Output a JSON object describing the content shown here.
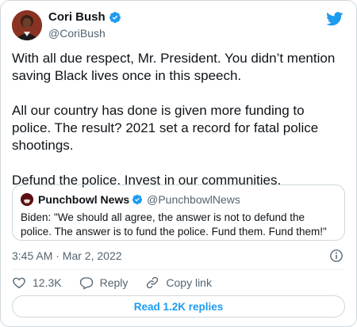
{
  "author": {
    "name": "Cori Bush",
    "handle": "@CoriBush",
    "avatar_icon": "profile-photo"
  },
  "tweet": {
    "paragraphs": [
      "With all due respect, Mr. President. You didn’t mention saving Black lives once in this speech.",
      "All our country has done is given more funding to police. The result? 2021 set a record for fatal police shootings.",
      "Defund the police. Invest in our communities."
    ],
    "timestamp": "3:45 AM · Mar 2, 2022"
  },
  "quoted": {
    "name": "Punchbowl News",
    "handle": "@PunchbowlNews",
    "text": "Biden: \"We should all agree, the answer is not to defund the police. The answer is to fund the police. Fund them. Fund them!\""
  },
  "actions": {
    "like_count": "12.3K",
    "reply_label": "Reply",
    "copy_label": "Copy link"
  },
  "replies_button": "Read 1.2K replies",
  "colors": {
    "accent": "#1d9bf0",
    "text": "#0f1419",
    "muted": "#536471",
    "border": "#cfd9de"
  }
}
